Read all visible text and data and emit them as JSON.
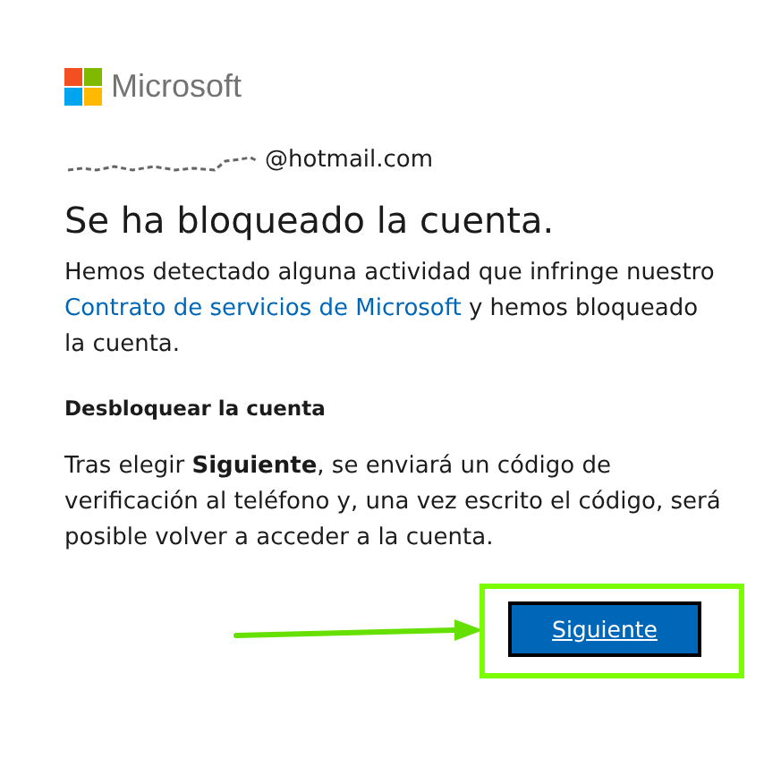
{
  "brand": {
    "name": "Microsoft"
  },
  "account": {
    "email": "@hotmail.com"
  },
  "title": "Se ha bloqueado la cuenta.",
  "intro": {
    "before": "Hemos detectado alguna actividad que infringe nuestro ",
    "link": "Contrato de servicios de Microsoft",
    "after": " y hemos bloqueado la cuenta."
  },
  "section_heading": "Desbloquear la cuenta",
  "instructions": "Tras elegir **Siguiente**, se enviará un código de verificación al teléfono y, una vez escrito el código, será posible volver a acceder a la cuenta.",
  "button": {
    "label": "Siguiente",
    "highlighted": true
  }
}
